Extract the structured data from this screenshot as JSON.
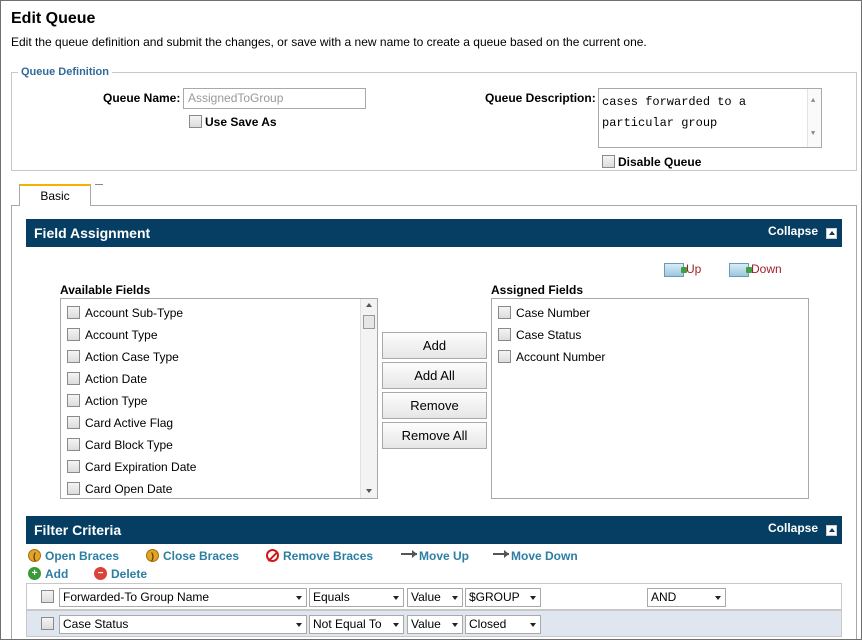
{
  "page": {
    "title": "Edit Queue",
    "description": "Edit the queue definition and submit the changes, or save with a new name to create a queue based on the current one."
  },
  "queue_definition": {
    "legend": "Queue Definition",
    "name_label": "Queue Name:",
    "name_value": "AssignedToGroup",
    "use_save_as_label": "Use Save As",
    "description_label": "Queue Description:",
    "description_line1": "cases forwarded to a",
    "description_line2": "particular group",
    "disable_queue_label": "Disable Queue"
  },
  "tabs": [
    {
      "label": "Basic",
      "selected": true
    }
  ],
  "field_assignment": {
    "title": "Field Assignment",
    "collapse_label": "Collapse",
    "up_label": "Up",
    "down_label": "Down",
    "available_label": "Available Fields",
    "assigned_label": "Assigned Fields",
    "available_fields": [
      "Account Sub-Type",
      "Account Type",
      "Action Case Type",
      "Action Date",
      "Action Type",
      "Card Active Flag",
      "Card Block Type",
      "Card Expiration Date",
      "Card Open Date"
    ],
    "assigned_fields": [
      "Case Number",
      "Case Status",
      "Account Number"
    ],
    "buttons": {
      "add": "Add",
      "add_all": "Add All",
      "remove": "Remove",
      "remove_all": "Remove All"
    }
  },
  "filter_criteria": {
    "title": "Filter Criteria",
    "collapse_label": "Collapse",
    "toolbar": {
      "open_braces": "Open Braces",
      "close_braces": "Close Braces",
      "remove_braces": "Remove Braces",
      "move_up": "Move Up",
      "move_down": "Move Down",
      "add": "Add",
      "delete": "Delete"
    },
    "rows": [
      {
        "field": "Forwarded-To Group Name",
        "operator": "Equals",
        "value_type": "Value",
        "value": "$GROUP",
        "connector": "AND"
      },
      {
        "field": "Case Status",
        "operator": "Not Equal To",
        "value_type": "Value",
        "value": "Closed"
      }
    ]
  },
  "colors": {
    "section_bar": "#053e62",
    "link": "#2c7ea3",
    "up_down": "#a0202b",
    "tab_accent": "#f5b100"
  }
}
